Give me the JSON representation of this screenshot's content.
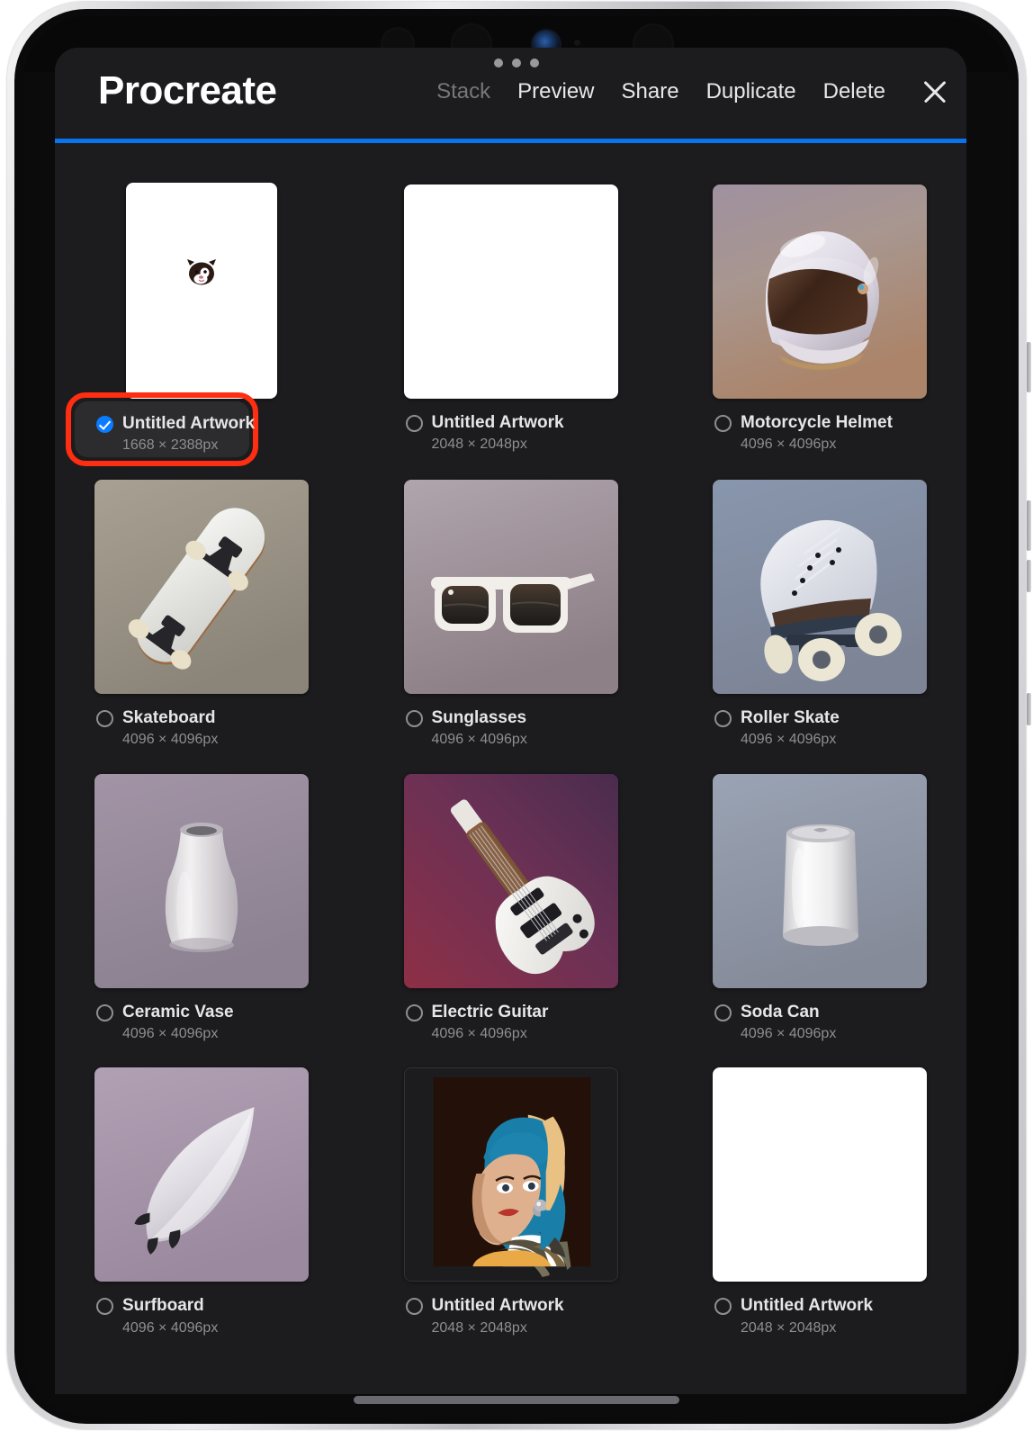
{
  "app": {
    "title": "Procreate",
    "accent_color": "#0a74f0",
    "panel_bg": "#1c1c1e",
    "annotation_color": "#ff2d11",
    "checkbox_color": "#0a7cff"
  },
  "header": {
    "actions": [
      {
        "label": "Stack",
        "state": "disabled"
      },
      {
        "label": "Preview",
        "state": "enabled"
      },
      {
        "label": "Share",
        "state": "enabled"
      },
      {
        "label": "Duplicate",
        "state": "enabled"
      },
      {
        "label": "Delete",
        "state": "enabled"
      }
    ],
    "close_icon": "close-x-icon"
  },
  "gallery": {
    "items": [
      {
        "name": "Untitled Artwork",
        "dimensions": "1668 × 2388px",
        "selected": true,
        "orientation": "portrait",
        "thumb": "dog-sketch-white"
      },
      {
        "name": "Untitled Artwork",
        "dimensions": "2048 × 2048px",
        "selected": false,
        "orientation": "square",
        "thumb": "blank-white"
      },
      {
        "name": "Motorcycle Helmet",
        "dimensions": "4096 × 4096px",
        "selected": false,
        "orientation": "square",
        "thumb": "helmet"
      },
      {
        "name": "Skateboard",
        "dimensions": "4096 × 4096px",
        "selected": false,
        "orientation": "square",
        "thumb": "skateboard"
      },
      {
        "name": "Sunglasses",
        "dimensions": "4096 × 4096px",
        "selected": false,
        "orientation": "square",
        "thumb": "sunglasses"
      },
      {
        "name": "Roller Skate",
        "dimensions": "4096 × 4096px",
        "selected": false,
        "orientation": "square",
        "thumb": "rollerskate"
      },
      {
        "name": "Ceramic Vase",
        "dimensions": "4096 × 4096px",
        "selected": false,
        "orientation": "square",
        "thumb": "vase"
      },
      {
        "name": "Electric Guitar",
        "dimensions": "4096 × 4096px",
        "selected": false,
        "orientation": "square",
        "thumb": "guitar"
      },
      {
        "name": "Soda Can",
        "dimensions": "4096 × 4096px",
        "selected": false,
        "orientation": "square",
        "thumb": "sodacan"
      },
      {
        "name": "Surfboard",
        "dimensions": "4096 × 4096px",
        "selected": false,
        "orientation": "square",
        "thumb": "surfboard"
      },
      {
        "name": "Untitled Artwork",
        "dimensions": "2048 × 2048px",
        "selected": false,
        "orientation": "square",
        "thumb": "pearl-earring"
      },
      {
        "name": "Untitled Artwork",
        "dimensions": "2048 × 2048px",
        "selected": false,
        "orientation": "square",
        "thumb": "blank-white"
      }
    ]
  },
  "device": {
    "camera_icons": [
      "camera-dot",
      "camera-dot",
      "face-id-lens",
      "sensor-pin",
      "camera-dot"
    ],
    "multitask_indicator": "three-dots-icon",
    "home_indicator": "home-indicator-bar"
  }
}
